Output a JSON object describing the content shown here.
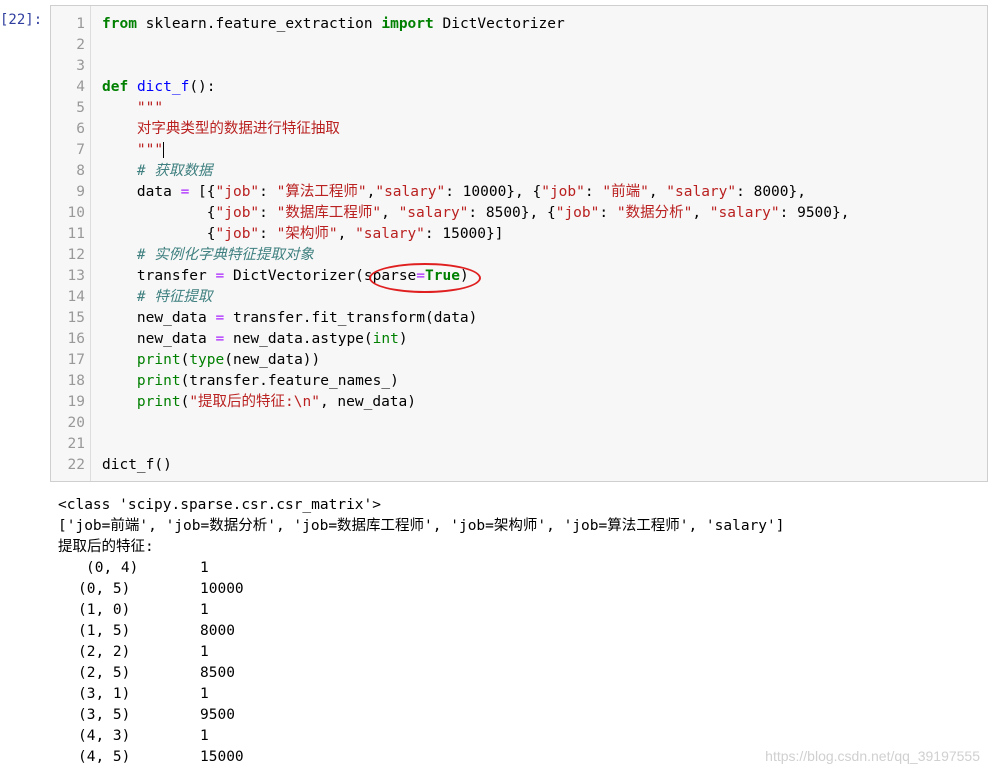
{
  "cell": {
    "prompt": "[22]:",
    "lines": [
      {
        "n": "1",
        "tokens": [
          {
            "t": "from",
            "c": "kw"
          },
          {
            "t": " sklearn.feature_extraction "
          },
          {
            "t": "import",
            "c": "kw"
          },
          {
            "t": " DictVectorizer"
          }
        ]
      },
      {
        "n": "2",
        "tokens": []
      },
      {
        "n": "3",
        "tokens": []
      },
      {
        "n": "4",
        "tokens": [
          {
            "t": "def",
            "c": "kw"
          },
          {
            "t": " "
          },
          {
            "t": "dict_f",
            "c": "fn"
          },
          {
            "t": "():"
          }
        ]
      },
      {
        "n": "5",
        "tokens": [
          {
            "t": "    "
          },
          {
            "t": "\"\"\"",
            "c": "st"
          }
        ]
      },
      {
        "n": "6",
        "tokens": [
          {
            "t": "    "
          },
          {
            "t": "对字典类型的数据进行特征抽取",
            "c": "st"
          }
        ]
      },
      {
        "n": "7",
        "tokens": [
          {
            "t": "    "
          },
          {
            "t": "\"\"\"",
            "c": "st"
          },
          {
            "t": "",
            "c": "cursor"
          }
        ]
      },
      {
        "n": "8",
        "tokens": [
          {
            "t": "    "
          },
          {
            "t": "# 获取数据",
            "c": "cm"
          }
        ]
      },
      {
        "n": "9",
        "tokens": [
          {
            "t": "    data "
          },
          {
            "t": "=",
            "c": "op"
          },
          {
            "t": " [{"
          },
          {
            "t": "\"job\"",
            "c": "st"
          },
          {
            "t": ": "
          },
          {
            "t": "\"算法工程师\"",
            "c": "st"
          },
          {
            "t": ","
          },
          {
            "t": "\"salary\"",
            "c": "st"
          },
          {
            "t": ": 10000}, {"
          },
          {
            "t": "\"job\"",
            "c": "st"
          },
          {
            "t": ": "
          },
          {
            "t": "\"前端\"",
            "c": "st"
          },
          {
            "t": ", "
          },
          {
            "t": "\"salary\"",
            "c": "st"
          },
          {
            "t": ": 8000},"
          }
        ]
      },
      {
        "n": "10",
        "tokens": [
          {
            "t": "            {"
          },
          {
            "t": "\"job\"",
            "c": "st"
          },
          {
            "t": ": "
          },
          {
            "t": "\"数据库工程师\"",
            "c": "st"
          },
          {
            "t": ", "
          },
          {
            "t": "\"salary\"",
            "c": "st"
          },
          {
            "t": ": 8500}, {"
          },
          {
            "t": "\"job\"",
            "c": "st"
          },
          {
            "t": ": "
          },
          {
            "t": "\"数据分析\"",
            "c": "st"
          },
          {
            "t": ", "
          },
          {
            "t": "\"salary\"",
            "c": "st"
          },
          {
            "t": ": 9500},"
          }
        ]
      },
      {
        "n": "11",
        "tokens": [
          {
            "t": "            {"
          },
          {
            "t": "\"job\"",
            "c": "st"
          },
          {
            "t": ": "
          },
          {
            "t": "\"架构师\"",
            "c": "st"
          },
          {
            "t": ", "
          },
          {
            "t": "\"salary\"",
            "c": "st"
          },
          {
            "t": ": 15000}]"
          }
        ]
      },
      {
        "n": "12",
        "tokens": [
          {
            "t": "    "
          },
          {
            "t": "# 实例化字典特征提取对象",
            "c": "cm"
          }
        ]
      },
      {
        "n": "13",
        "tokens": [
          {
            "t": "    transfer "
          },
          {
            "t": "=",
            "c": "op"
          },
          {
            "t": " DictVectorizer(sparse"
          },
          {
            "t": "=",
            "c": "op"
          },
          {
            "t": "True",
            "c": "kw"
          },
          {
            "t": ")"
          }
        ]
      },
      {
        "n": "14",
        "tokens": [
          {
            "t": "    "
          },
          {
            "t": "# 特征提取",
            "c": "cm"
          }
        ]
      },
      {
        "n": "15",
        "tokens": [
          {
            "t": "    new_data "
          },
          {
            "t": "=",
            "c": "op"
          },
          {
            "t": " transfer.fit_transform(data)"
          }
        ]
      },
      {
        "n": "16",
        "tokens": [
          {
            "t": "    new_data "
          },
          {
            "t": "=",
            "c": "op"
          },
          {
            "t": " new_data.astype("
          },
          {
            "t": "int",
            "c": "bi"
          },
          {
            "t": ")"
          }
        ]
      },
      {
        "n": "17",
        "tokens": [
          {
            "t": "    "
          },
          {
            "t": "print",
            "c": "bi"
          },
          {
            "t": "("
          },
          {
            "t": "type",
            "c": "bi"
          },
          {
            "t": "(new_data))"
          }
        ]
      },
      {
        "n": "18",
        "tokens": [
          {
            "t": "    "
          },
          {
            "t": "print",
            "c": "bi"
          },
          {
            "t": "(transfer.feature_names_)"
          }
        ]
      },
      {
        "n": "19",
        "tokens": [
          {
            "t": "    "
          },
          {
            "t": "print",
            "c": "bi"
          },
          {
            "t": "("
          },
          {
            "t": "\"提取后的特征:\\n\"",
            "c": "st"
          },
          {
            "t": ", new_data)"
          }
        ]
      },
      {
        "n": "20",
        "tokens": []
      },
      {
        "n": "21",
        "tokens": []
      },
      {
        "n": "22",
        "tokens": [
          {
            "t": "dict_f()"
          }
        ]
      }
    ]
  },
  "output": {
    "lines": [
      "<class 'scipy.sparse.csr.csr_matrix'>",
      "['job=前端', 'job=数据分析', 'job=数据库工程师', 'job=架构师', 'job=算法工程师', 'salary']",
      "提取后的特征:"
    ],
    "rows": [
      {
        "idx": "(0, 4)",
        "val": "1"
      },
      {
        "idx": "(0, 5)",
        "val": "10000"
      },
      {
        "idx": "(1, 0)",
        "val": "1"
      },
      {
        "idx": "(1, 5)",
        "val": "8000"
      },
      {
        "idx": "(2, 2)",
        "val": "1"
      },
      {
        "idx": "(2, 5)",
        "val": "8500"
      },
      {
        "idx": "(3, 1)",
        "val": "1"
      },
      {
        "idx": "(3, 5)",
        "val": "9500"
      },
      {
        "idx": "(4, 3)",
        "val": "1"
      },
      {
        "idx": "(4, 5)",
        "val": "15000"
      }
    ]
  },
  "watermark": "https://blog.csdn.net/qq_39197555"
}
